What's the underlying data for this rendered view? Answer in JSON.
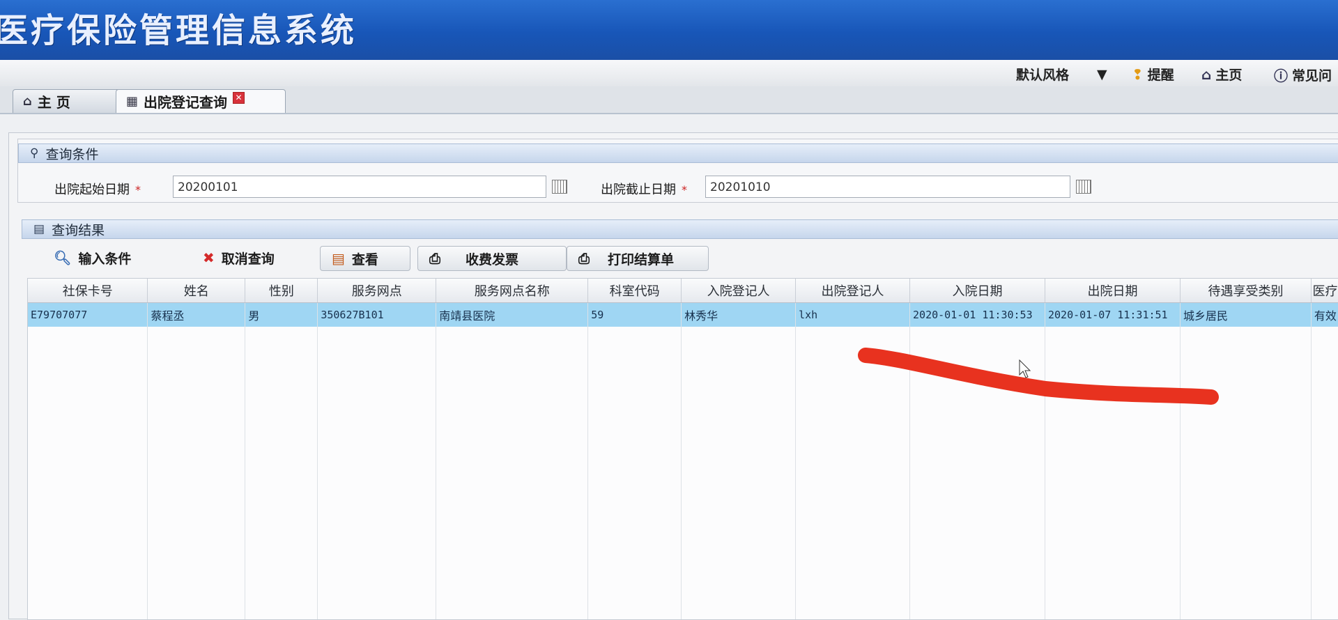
{
  "app": {
    "title": "医疗保险管理信息系统"
  },
  "topbar": {
    "style_label": "默认风格",
    "style_dropdown": "▼",
    "remind_label": "提醒",
    "home_label": "主页",
    "faq_label": "常见问"
  },
  "tabs": [
    {
      "label": "主 页",
      "icon": "home-icon"
    },
    {
      "label": "出院登记查询",
      "icon": "calendar-icon",
      "closable": true
    }
  ],
  "query": {
    "section_title": "查询条件",
    "start_label": "出院起始日期",
    "start_value": "20200101",
    "end_label": "出院截止日期",
    "end_value": "20201010",
    "required_mark": "*"
  },
  "results": {
    "section_title": "查询结果",
    "toolbar": {
      "input_conditions": "输入条件",
      "cancel_query": "取消查询",
      "view": "查看",
      "invoice": "收费发票",
      "print_settlement": "打印结算单"
    },
    "columns": [
      "社保卡号",
      "姓名",
      "性别",
      "服务网点",
      "服务网点名称",
      "科室代码",
      "入院登记人",
      "出院登记人",
      "入院日期",
      "出院日期",
      "待遇享受类别",
      "医疗"
    ],
    "rows": [
      [
        "E79707077",
        "蔡程丞",
        "男",
        "350627B101",
        "南靖县医院",
        "59",
        "林秀华",
        "lxh",
        "2020-01-01 11:30:53",
        "2020-01-07 11:31:51",
        "城乡居民",
        "有效"
      ]
    ]
  },
  "colors": {
    "banner": "#1856b8",
    "selected_row": "#9fd6f3",
    "scribble": "#e8321f"
  }
}
